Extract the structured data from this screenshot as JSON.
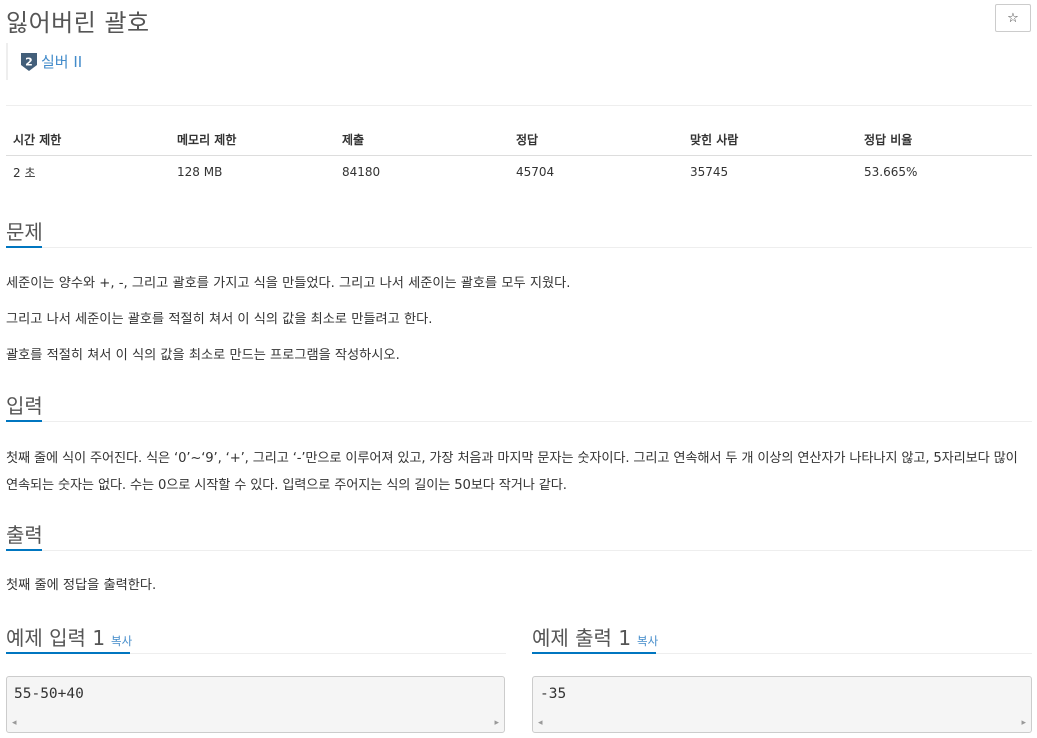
{
  "problem": {
    "title": "잃어버린 괄호",
    "star": "☆",
    "tier_number": "2",
    "tier_label": "실버 II"
  },
  "info_table": {
    "headers": [
      "시간 제한",
      "메모리 제한",
      "제출",
      "정답",
      "맞힌 사람",
      "정답 비율"
    ],
    "values": [
      "2 초",
      "128 MB",
      "84180",
      "45704",
      "35745",
      "53.665%"
    ]
  },
  "sections": {
    "description": {
      "heading": "문제",
      "paragraphs": [
        "세준이는 양수와 +, -, 그리고 괄호를 가지고 식을 만들었다. 그리고 나서 세준이는 괄호를 모두 지웠다.",
        "그리고 나서 세준이는 괄호를 적절히 쳐서 이 식의 값을 최소로 만들려고 한다.",
        "괄호를 적절히 쳐서 이 식의 값을 최소로 만드는 프로그램을 작성하시오."
      ]
    },
    "input": {
      "heading": "입력",
      "paragraph": "첫째 줄에 식이 주어진다. 식은 ‘0’~‘9’, ‘+’, 그리고 ‘-’만으로 이루어져 있고, 가장 처음과 마지막 문자는 숫자이다. 그리고 연속해서 두 개 이상의 연산자가 나타나지 않고, 5자리보다 많이 연속되는 숫자는 없다. 수는 0으로 시작할 수 있다. 입력으로 주어지는 식의 길이는 50보다 작거나 같다."
    },
    "output": {
      "heading": "출력",
      "paragraph": "첫째 줄에 정답을 출력한다."
    }
  },
  "samples": {
    "input_heading": "예제 입력 1",
    "output_heading": "예제 출력 1",
    "copy_label": "복사",
    "input_value": "55-50+40",
    "output_value": "-35",
    "scroll_left": "◂",
    "scroll_right": "▸"
  },
  "colors": {
    "accent": "#0076c0",
    "link": "#428bca",
    "tier_badge": "#435f7a"
  }
}
